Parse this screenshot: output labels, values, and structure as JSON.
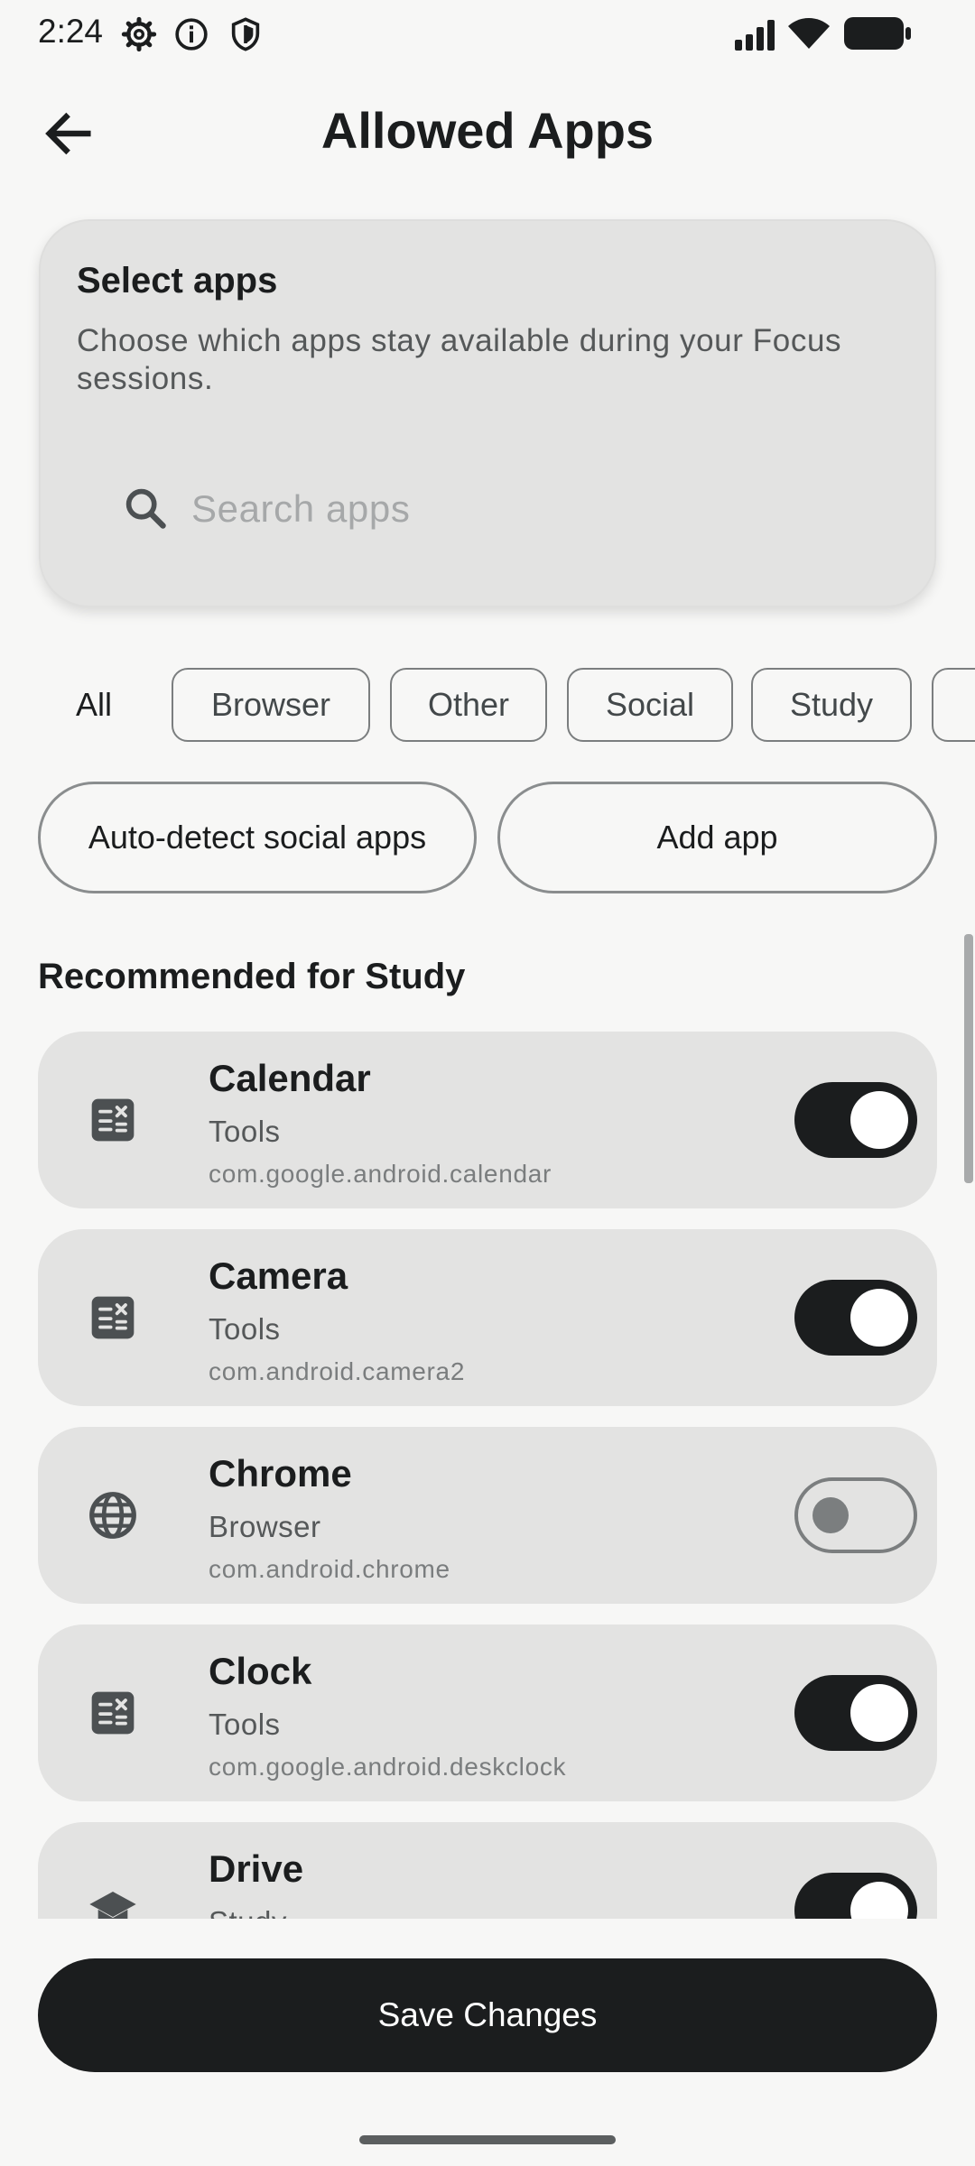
{
  "status_bar": {
    "time": "2:24",
    "icons": [
      "settings-icon",
      "info-icon",
      "shield-icon",
      "signal-icon",
      "wifi-icon",
      "battery-icon"
    ]
  },
  "header": {
    "title": "Allowed Apps",
    "back_icon": "arrow-back-icon"
  },
  "select_card": {
    "title": "Select apps",
    "description": "Choose which apps stay available during your Focus sessions.",
    "search_placeholder": "Search apps",
    "search_value": ""
  },
  "filters": {
    "selected": "All",
    "chips": [
      "All",
      "Browser",
      "Other",
      "Social",
      "Study"
    ]
  },
  "actions": {
    "auto_detect": "Auto-detect social apps",
    "add_app": "Add app"
  },
  "section_title": "Recommended for Study",
  "apps": [
    {
      "name": "Calendar",
      "category": "Tools",
      "package": "com.google.android.calendar",
      "enabled": true,
      "icon": "tools-icon"
    },
    {
      "name": "Camera",
      "category": "Tools",
      "package": "com.android.camera2",
      "enabled": true,
      "icon": "tools-icon"
    },
    {
      "name": "Chrome",
      "category": "Browser",
      "package": "com.android.chrome",
      "enabled": false,
      "icon": "globe-icon"
    },
    {
      "name": "Clock",
      "category": "Tools",
      "package": "com.google.android.deskclock",
      "enabled": true,
      "icon": "tools-icon"
    },
    {
      "name": "Drive",
      "category": "Study",
      "package": "",
      "enabled": true,
      "icon": "school-icon"
    }
  ],
  "save_button": "Save Changes",
  "colors": {
    "background": "#f7f7f6",
    "card": "#e3e3e2",
    "accent": "#1b1d1e"
  }
}
